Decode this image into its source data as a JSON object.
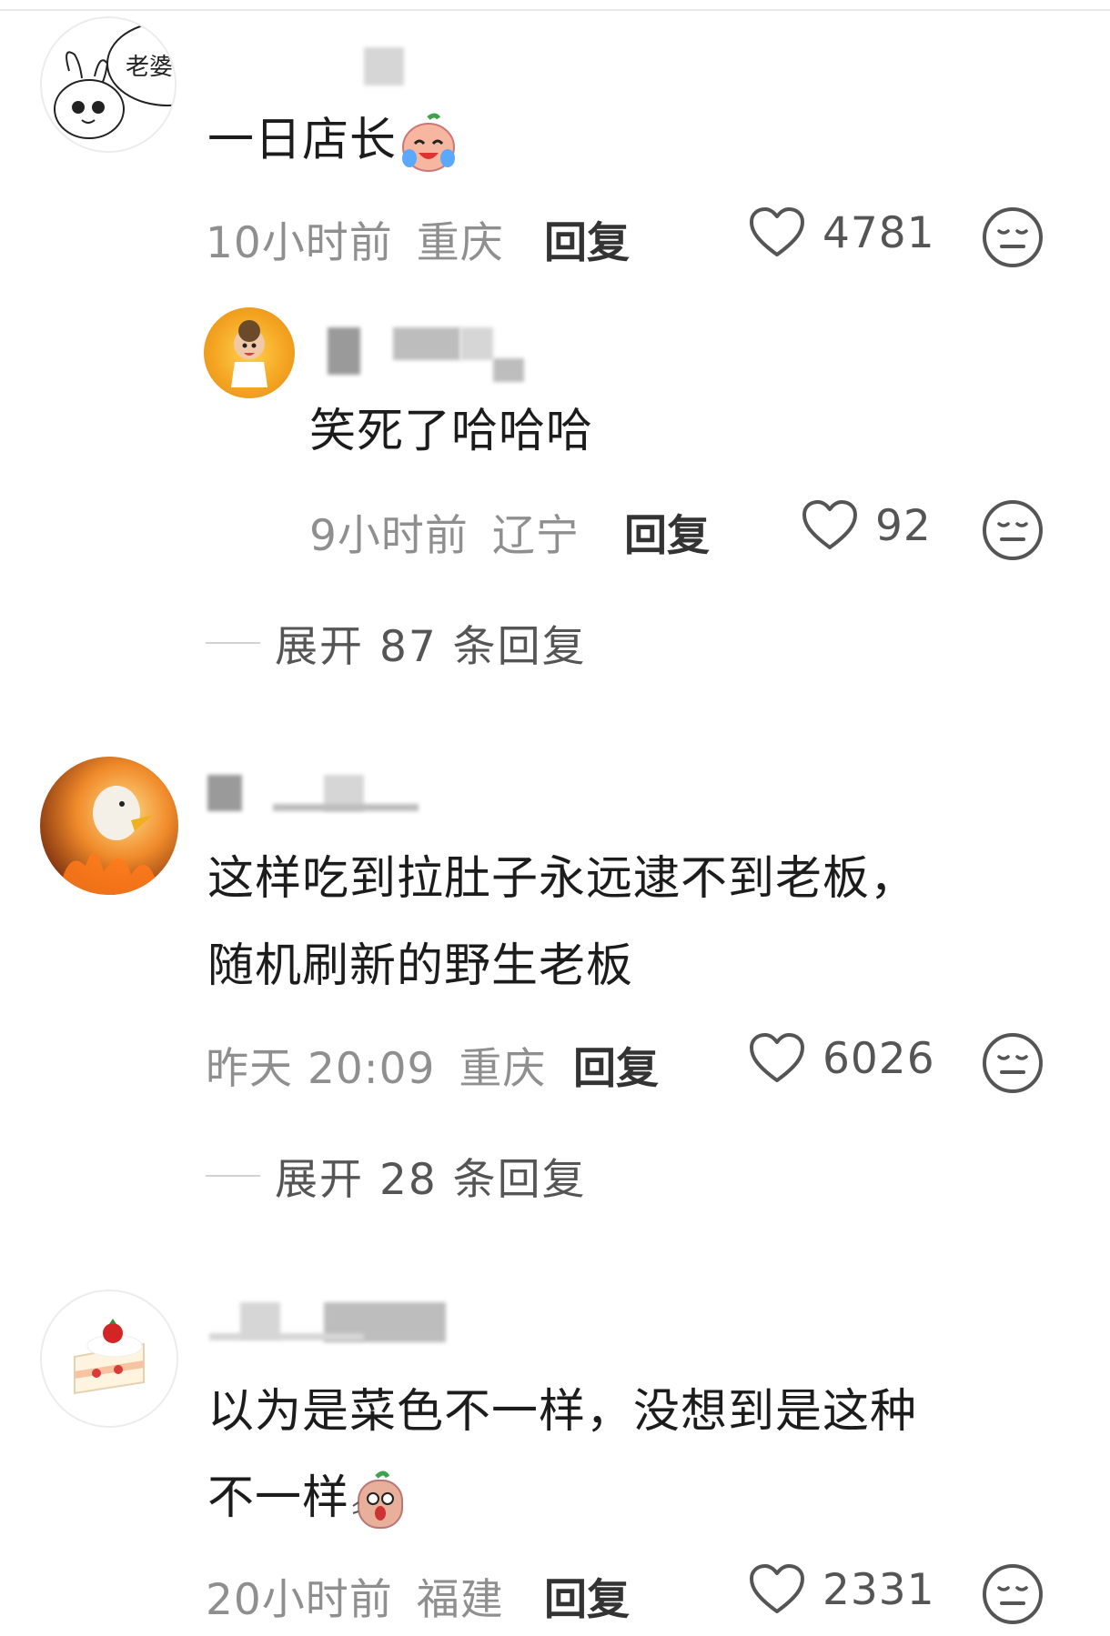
{
  "comments": [
    {
      "text": "一日店长",
      "avatar_text": "老婆",
      "time": "10小时前",
      "location": "重庆",
      "reply_label": "回复",
      "likes": "4781",
      "reply": {
        "text": "笑死了哈哈哈",
        "time": "9小时前",
        "location": "辽宁",
        "reply_label": "回复",
        "likes": "92"
      },
      "expand_label": "展开 87 条回复"
    },
    {
      "text_line1": "这样吃到拉肚子永远逮不到老板，",
      "text_line2": "随机刷新的野生老板",
      "time": "昨天 20:09",
      "location": "重庆",
      "reply_label": "回复",
      "likes": "6026",
      "expand_label": "展开 28 条回复"
    },
    {
      "text_line1": "以为是菜色不一样，没想到是这种",
      "text_line2": "不一样",
      "time": "20小时前",
      "location": "福建",
      "reply_label": "回复",
      "likes": "2331"
    }
  ]
}
